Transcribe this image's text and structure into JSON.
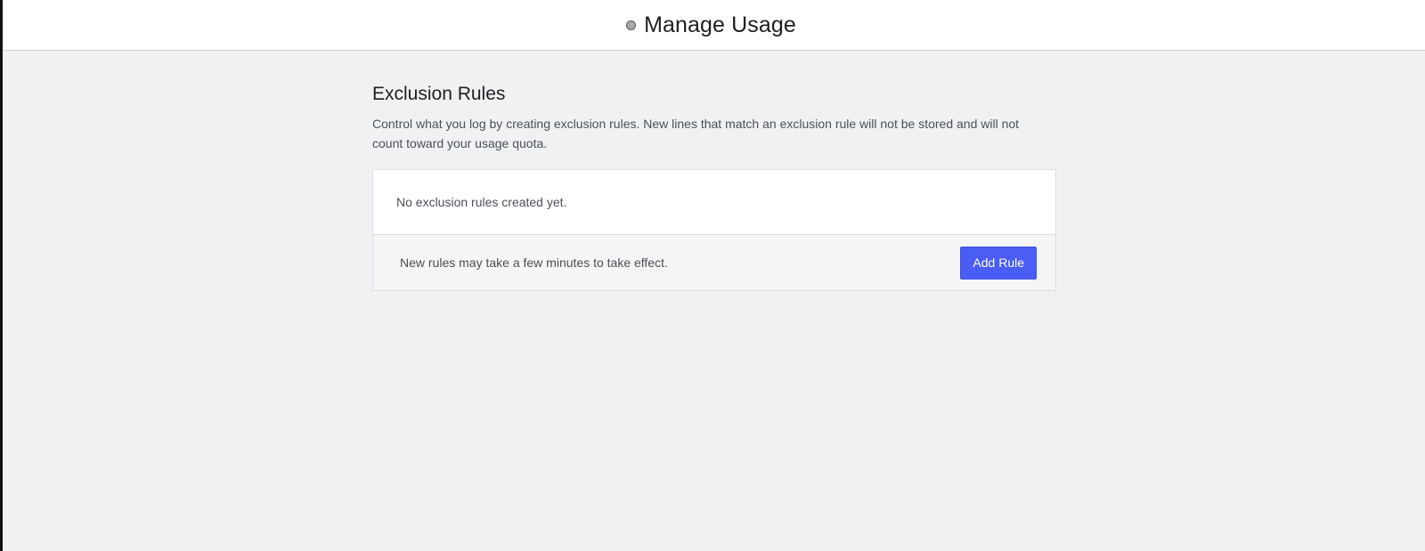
{
  "header": {
    "title": "Manage Usage",
    "status_icon": "status-dot-icon"
  },
  "exclusion_rules": {
    "title": "Exclusion Rules",
    "description": "Control what you log by creating exclusion rules. New lines that match an exclusion rule will not be stored and will not count toward your usage quota.",
    "empty_message": "No exclusion rules created yet.",
    "footer_note": "New rules may take a few minutes to take effect.",
    "add_button_label": "Add Rule"
  },
  "colors": {
    "accent": "#4a5df5",
    "page_background": "#f0f1f3",
    "panel_background": "#ffffff",
    "footer_background": "#f5f5f6"
  }
}
